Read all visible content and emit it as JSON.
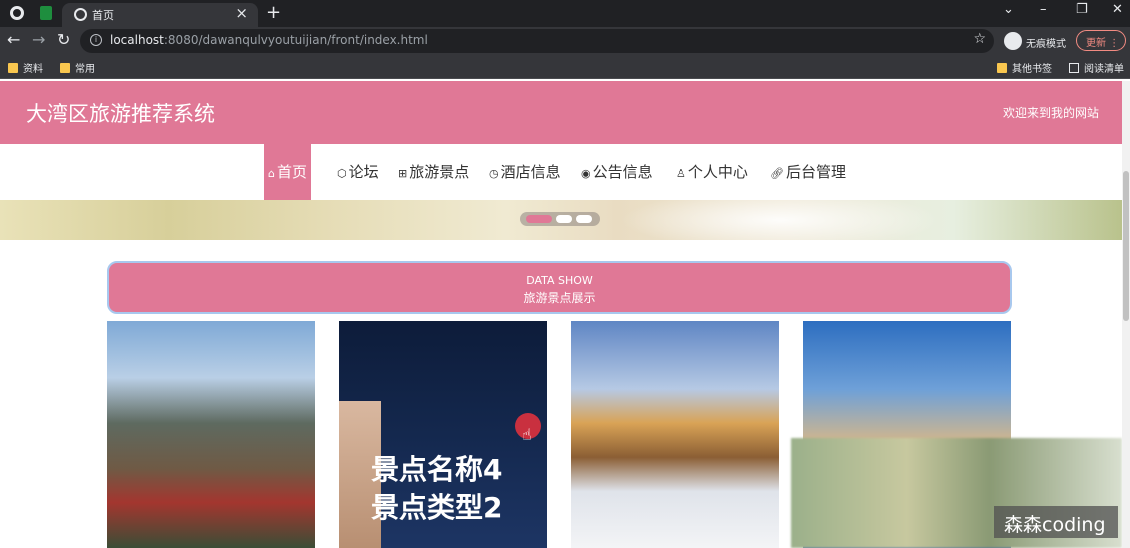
{
  "browser": {
    "tab_title": "首页",
    "url_host": "localhost",
    "url_rest": ":8080/dawanqulvyoutuijian/front/index.html",
    "incognito_label": "无痕模式",
    "update_label": "更新",
    "bookmarks": [
      "资料",
      "常用"
    ],
    "bookmarks_right": [
      "其他书签",
      "阅读清单"
    ]
  },
  "site": {
    "title": "大湾区旅游推荐系统",
    "welcome": "欢迎来到我的网站"
  },
  "nav": [
    {
      "icon": "home-icon",
      "label": "首页"
    },
    {
      "icon": "forum-icon",
      "label": "论坛"
    },
    {
      "icon": "scenic-icon",
      "label": "旅游景点"
    },
    {
      "icon": "hotel-icon",
      "label": "酒店信息"
    },
    {
      "icon": "notice-icon",
      "label": "公告信息"
    },
    {
      "icon": "user-icon",
      "label": "个人中心"
    },
    {
      "icon": "link-icon",
      "label": "后台管理"
    }
  ],
  "section": {
    "title_en": "DATA SHOW",
    "title_cn": "旅游景点展示"
  },
  "cards": [
    {
      "overlay_name": "",
      "overlay_type": ""
    },
    {
      "overlay_name": "景点名称4",
      "overlay_type": "景点类型2"
    },
    {
      "overlay_name": "",
      "overlay_type": ""
    },
    {
      "overlay_name": "",
      "overlay_type": ""
    }
  ],
  "watermark": "森森coding"
}
